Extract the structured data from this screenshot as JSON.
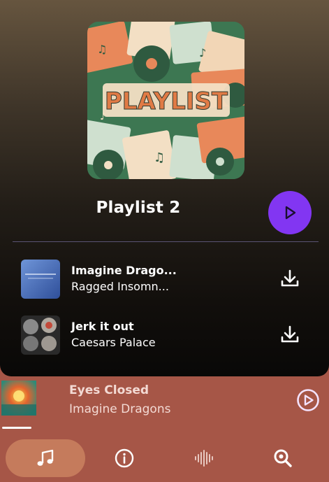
{
  "cover": {
    "text": "PLAYLIST"
  },
  "playlist": {
    "title": "Playlist 2"
  },
  "tracks": [
    {
      "title": "Imagine Drago...",
      "artist": "Ragged Insomn..."
    },
    {
      "title": "Jerk it out",
      "artist": "Caesars Palace"
    }
  ],
  "now_playing": {
    "title": "Eyes Closed",
    "artist": "Imagine Dragons",
    "progress": 0.09
  },
  "nav": {
    "items": [
      "music-note-icon",
      "info-icon",
      "waveform-icon",
      "search-icon"
    ],
    "active": 0
  },
  "colors": {
    "accent": "#8236f2",
    "mini_player_bg": "#a65647",
    "nav_active_bg": "#c57b5c"
  }
}
